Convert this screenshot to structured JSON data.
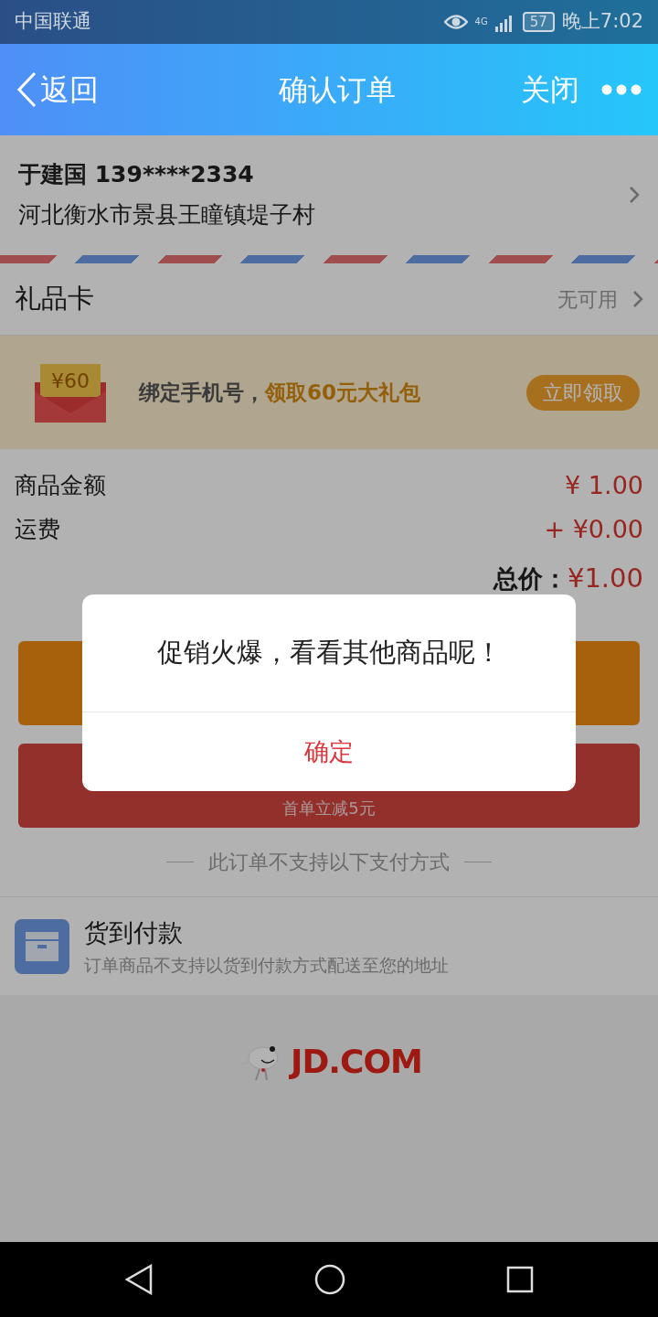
{
  "status_bar": {
    "carrier": "中国联通",
    "network": "4G",
    "battery": "57",
    "time": "晚上7:02"
  },
  "nav": {
    "back": "返回",
    "title": "确认订单",
    "close": "关闭"
  },
  "address": {
    "name": "于建国",
    "phone": "139****2334",
    "detail": "河北衡水市景县王瞳镇堤子村"
  },
  "gift_card": {
    "label": "礼品卡",
    "status": "无可用"
  },
  "promo": {
    "amount": "¥60",
    "lead": "绑定手机号，",
    "highlight": "领取60元大礼包",
    "button": "立即领取"
  },
  "amounts": [
    {
      "label": "商品金额",
      "value": "¥ 1.00"
    },
    {
      "label": "运费",
      "value": "+ ¥0.00"
    }
  ],
  "total": {
    "label": "总价：",
    "value": "¥1.00"
  },
  "pay_buttons": [
    {
      "kind": "orange"
    },
    {
      "kind": "jd",
      "subtitle": "首单立减5元"
    }
  ],
  "unsupported_heading": "此订单不支持以下支付方式",
  "unsupported_methods": [
    {
      "title": "货到付款",
      "note": "订单商品不支持以货到付款方式配送至您的地址"
    }
  ],
  "footer_logo": "JD.COM",
  "dialog": {
    "message": "促销火爆，看看其他商品呢！",
    "confirm": "确定"
  }
}
